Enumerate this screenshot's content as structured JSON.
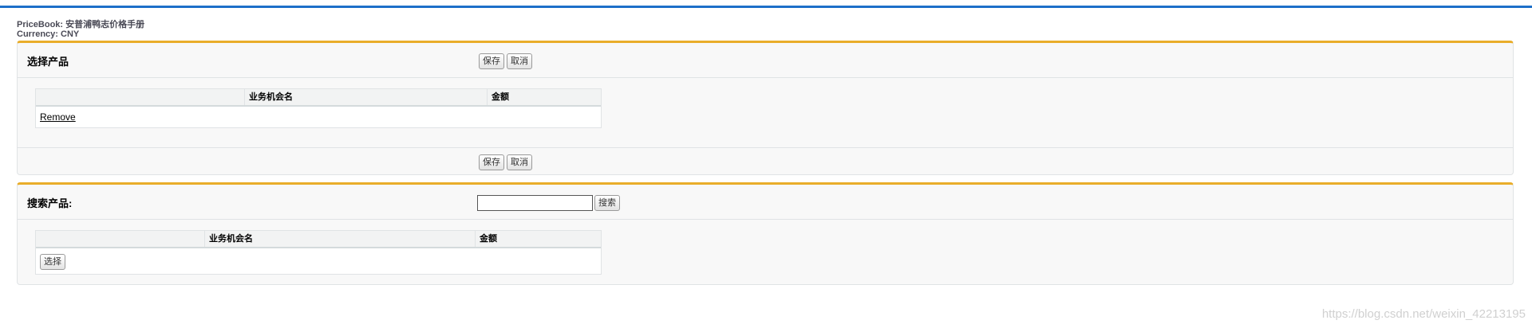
{
  "meta": {
    "pricebook_label": "PriceBook:",
    "pricebook_value": "安普浦鸭志价格手册",
    "currency_label": "Currency:",
    "currency_value": "CNY"
  },
  "select_section": {
    "title": "选择产品",
    "save_label": "保存",
    "cancel_label": "取消",
    "columns": [
      "",
      "业务机会名",
      "金额"
    ],
    "row_action": "Remove"
  },
  "search_section": {
    "title": "搜索产品:",
    "search_value": "",
    "search_button": "搜索",
    "columns": [
      "",
      "业务机会名",
      "金额"
    ],
    "row_action": "选择"
  },
  "watermark": "https://blog.csdn.net/weixin_42213195",
  "colors": {
    "accent": "#e9ad2a",
    "topbar": "#1d6fc9"
  }
}
